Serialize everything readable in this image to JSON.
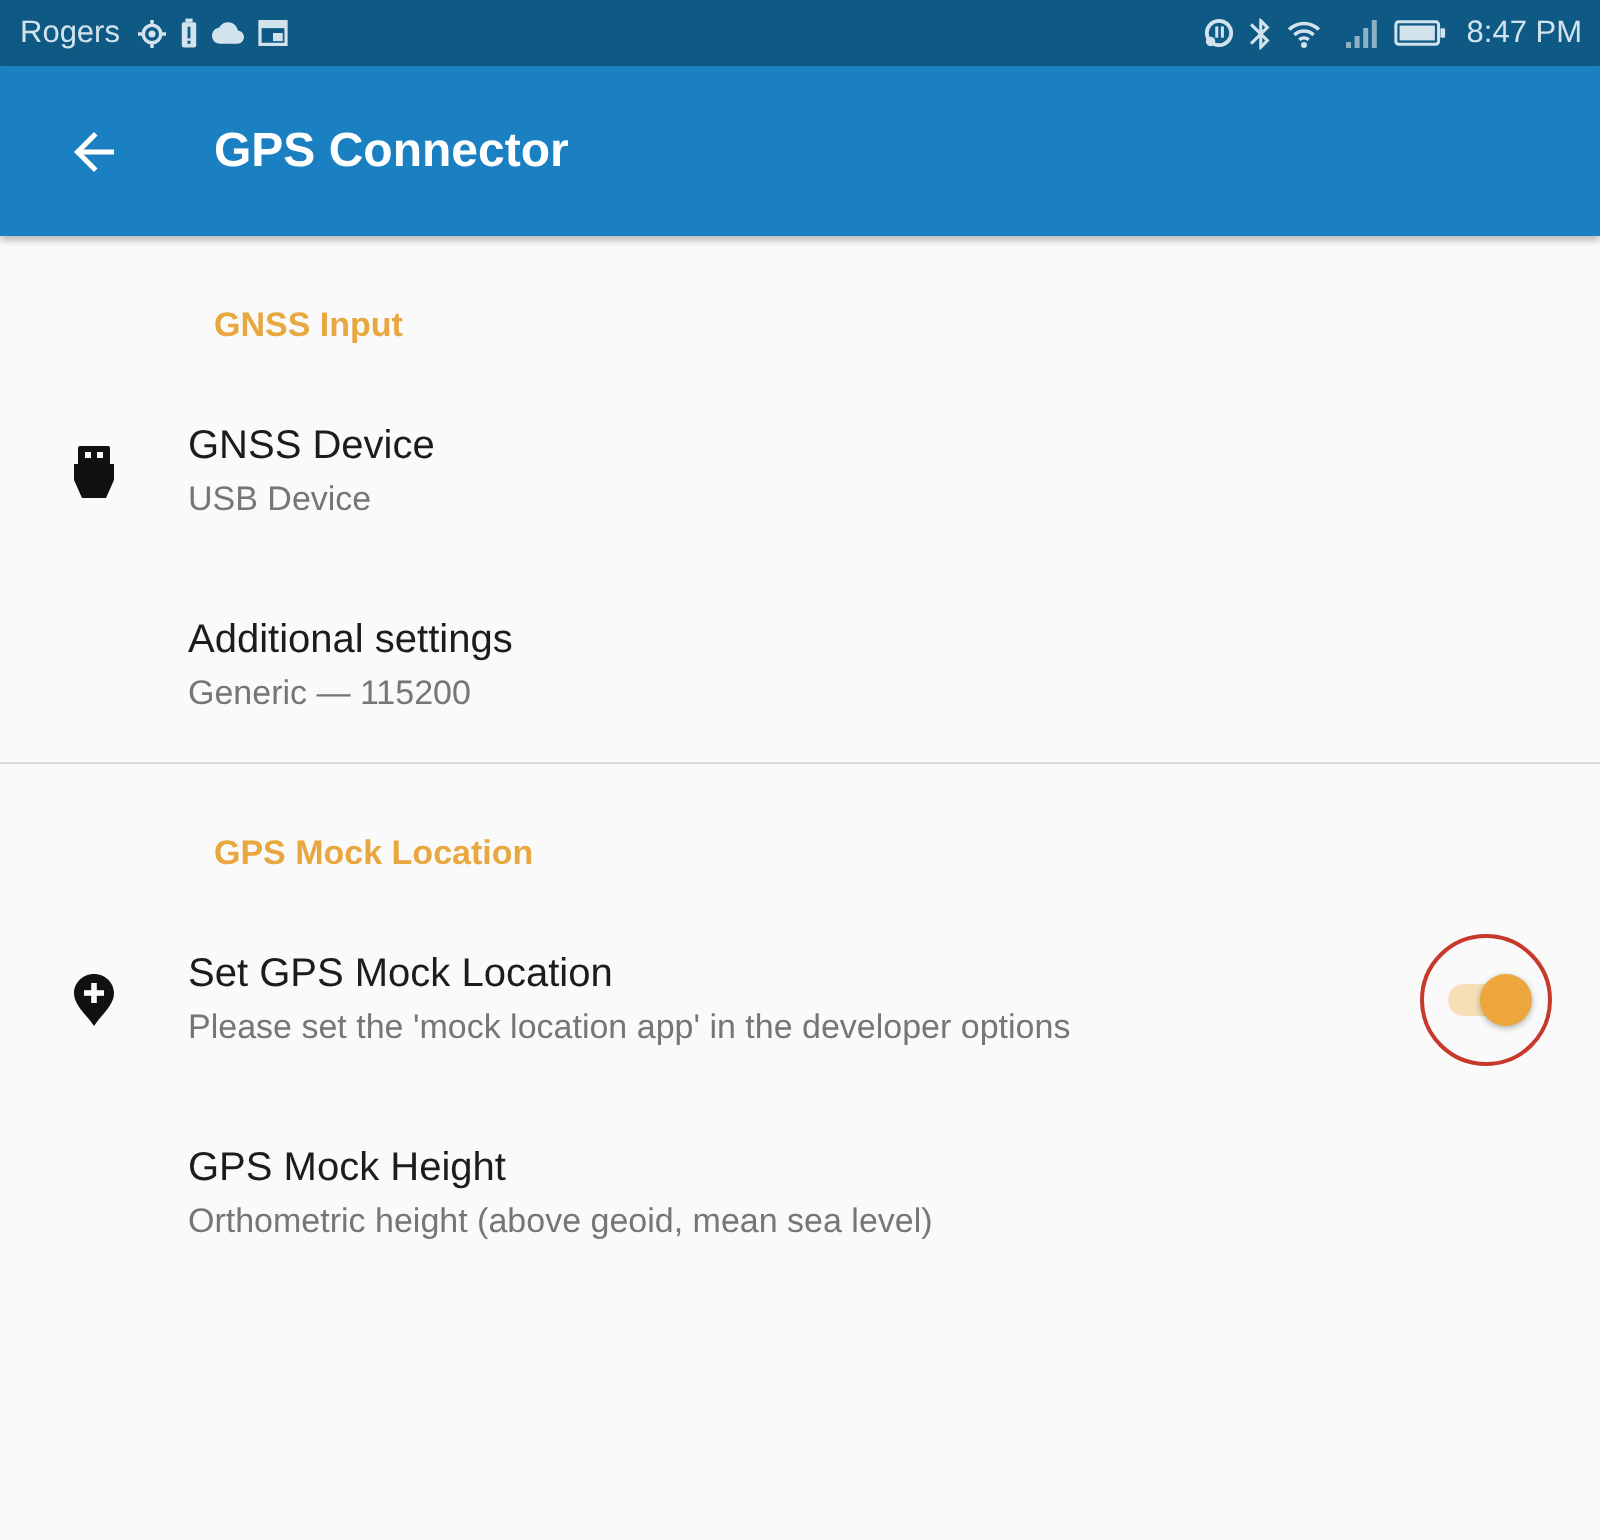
{
  "status_bar": {
    "carrier": "Rogers",
    "time": "8:47 PM"
  },
  "app_bar": {
    "title": "GPS Connector"
  },
  "sections": [
    {
      "header": "GNSS Input",
      "items": [
        {
          "kind": "device",
          "title": "GNSS Device",
          "summary": "USB Device"
        },
        {
          "kind": "plain",
          "title": "Additional settings",
          "summary": "Generic — 115200"
        }
      ]
    },
    {
      "header": "GPS Mock Location",
      "items": [
        {
          "kind": "switch",
          "title": "Set GPS Mock Location",
          "summary": "Please set the 'mock location app' in the developer options",
          "on": true,
          "highlighted": true
        },
        {
          "kind": "plain",
          "title": "GPS Mock Height",
          "summary": "Orthometric height (above geoid, mean sea level)"
        }
      ]
    }
  ]
}
